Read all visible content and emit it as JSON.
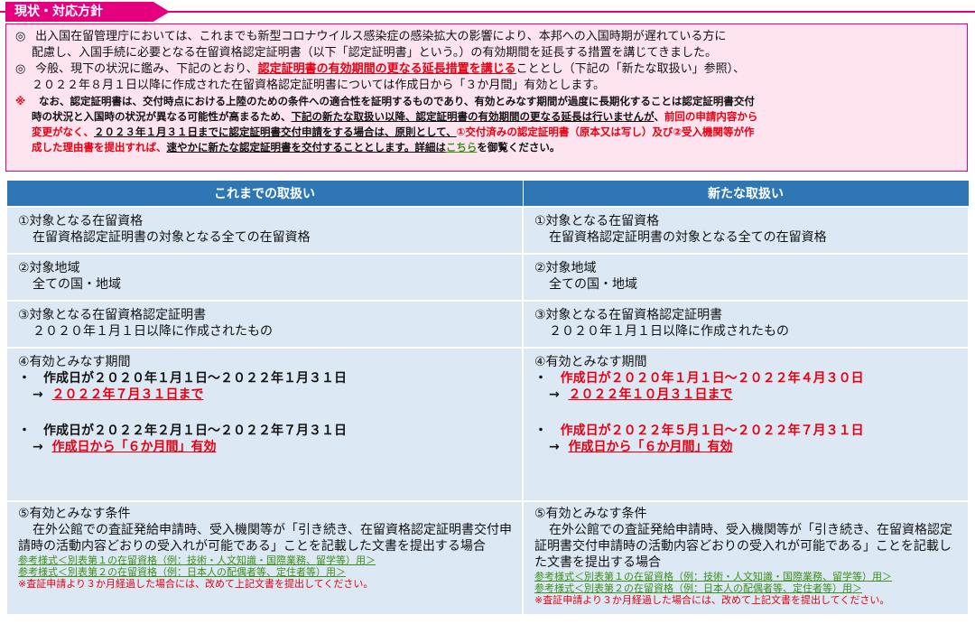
{
  "section_tag": "現状・対応方針",
  "intro": {
    "p1_mark": "◎",
    "p1_line1": "出入国在留管理庁においては、これまでも新型コロナウイルス感染症の感染拡大の影響により、本邦への入国時期が遅れている方に",
    "p1_line2": "配慮し、入国手続に必要となる在留資格認定証明書（以下「認定証明書」という。）の有効期間を延長する措置を講じてきました。",
    "p2_mark": "◎",
    "p2_text1": "今般、現下の状況に鑑み、下記のとおり、",
    "p2_red": "認定証明書の有効期間の更なる延長措置を講じる",
    "p2_text2": "こととし（下記の「新たな取扱い」参照）、",
    "p2_line2": "２０２２年８月１日以降に作成された在留資格認定証明書については作成日から「３か月間」有効とします。",
    "note_mark": "※",
    "note_line1": "なお、認定証明書は、交付時点における上陸のための条件への適合性を証明するものであり、有効とみなす期間が過度に長期化することは認定証明書交付",
    "note_line2a": "時の状況と入国時の状況が異なる可能性が高まるため、",
    "note_line2b": "下記の新たな取扱い以降、認定証明書の有効期間の更なる延長は行いませんが",
    "note_line2c": "、",
    "note_line2d": "前回の申請内容から",
    "note_line3a": "変更がなく、",
    "note_line3b": "２０２３年１月３１日までに認定証明書交付申請をする場合は、原則として、",
    "note_line3c": "①交付済みの認定証明書（原本又は写し）及び②受入機関等が作",
    "note_line4a": "成した理由書を提出すれば、",
    "note_line4b": "速やかに新たな認定証明書を交付することとします。詳細は",
    "note_link": "こちら",
    "note_line4c": "を御覧ください。"
  },
  "table": {
    "headers": [
      "これまでの取扱い",
      "新たな取扱い"
    ],
    "old": {
      "r1_title": "①対象となる在留資格",
      "r1_body": "在留資格認定証明書の対象となる全ての在留資格",
      "r2_title": "②対象地域",
      "r2_body": "全ての国・地域",
      "r3_title": "③対象となる在留資格認定証明書",
      "r3_body": "２０２０年１月１日以降に作成されたもの",
      "r4_title": "④有効とみなす期間",
      "r4_b1": "・　作成日が２０２０年１月１日～２０２２年１月３１日",
      "r4_b1_arrow": "→",
      "r4_b1_result": "２０２２年７月３１日まで",
      "r4_b2": "・　作成日が２０２２年２月１日～２０２２年７月３１日",
      "r4_b2_arrow": "→",
      "r4_b2_result": "作成日から「６か月間」有効",
      "r5_title": "⑤有効とみなす条件",
      "r5_body": "在外公館での査証発給申請時、受入機関等が「引き続き、在留資格認定証明書交付申請時の活動内容どおりの受入れが可能である」ことを記載した文書を提出する場合",
      "r5_ref1": "参考様式＜別表第１の在留資格（例：技術・人文知識・国際業務、留学等）用＞",
      "r5_ref2": "参考様式＜別表第２の在留資格（例：日本人の配偶者等、定住者等）用＞",
      "r5_note": "※査証申請より３か月経過した場合には、改めて上記文書を提出してください。"
    },
    "new": {
      "r1_title": "①対象となる在留資格",
      "r1_body": "在留資格認定証明書の対象となる全ての在留資格",
      "r2_title": "②対象地域",
      "r2_body": "全ての国・地域",
      "r3_title": "③対象となる在留資格認定証明書",
      "r3_body": "２０２０年１月１日以降に作成されたもの",
      "r4_title": "④有効とみなす期間",
      "r4_b1_dot": "・",
      "r4_b1": "作成日が２０２０年１月１日～２０２２年４月３０日",
      "r4_b1_arrow": "→",
      "r4_b1_result": "２０２２年１０月３１日まで",
      "r4_b2_dot": "・",
      "r4_b2": "作成日が２０２２年５月１日～２０２２年７月３１日",
      "r4_b2_arrow": "→",
      "r4_b2_result": "作成日から「６か月間」有効",
      "r5_title": "⑤有効とみなす条件",
      "r5_body": "在外公館での査証発給申請時、受入機関等が「引き続き、在留資格認定証明書交付申請時の活動内容どおりの受入れが可能である」ことを記載した文書を提出する場合",
      "r5_ref1": "参考様式＜別表第１の在留資格（例：技術・人文知識・国際業務、留学等）用＞",
      "r5_ref2": "参考様式＜別表第２の在留資格（例：日本人の配偶者等、定住者等）用＞",
      "r5_note": "※査証申請より３か月経過した場合には、改めて上記文書を提出してください。"
    }
  }
}
